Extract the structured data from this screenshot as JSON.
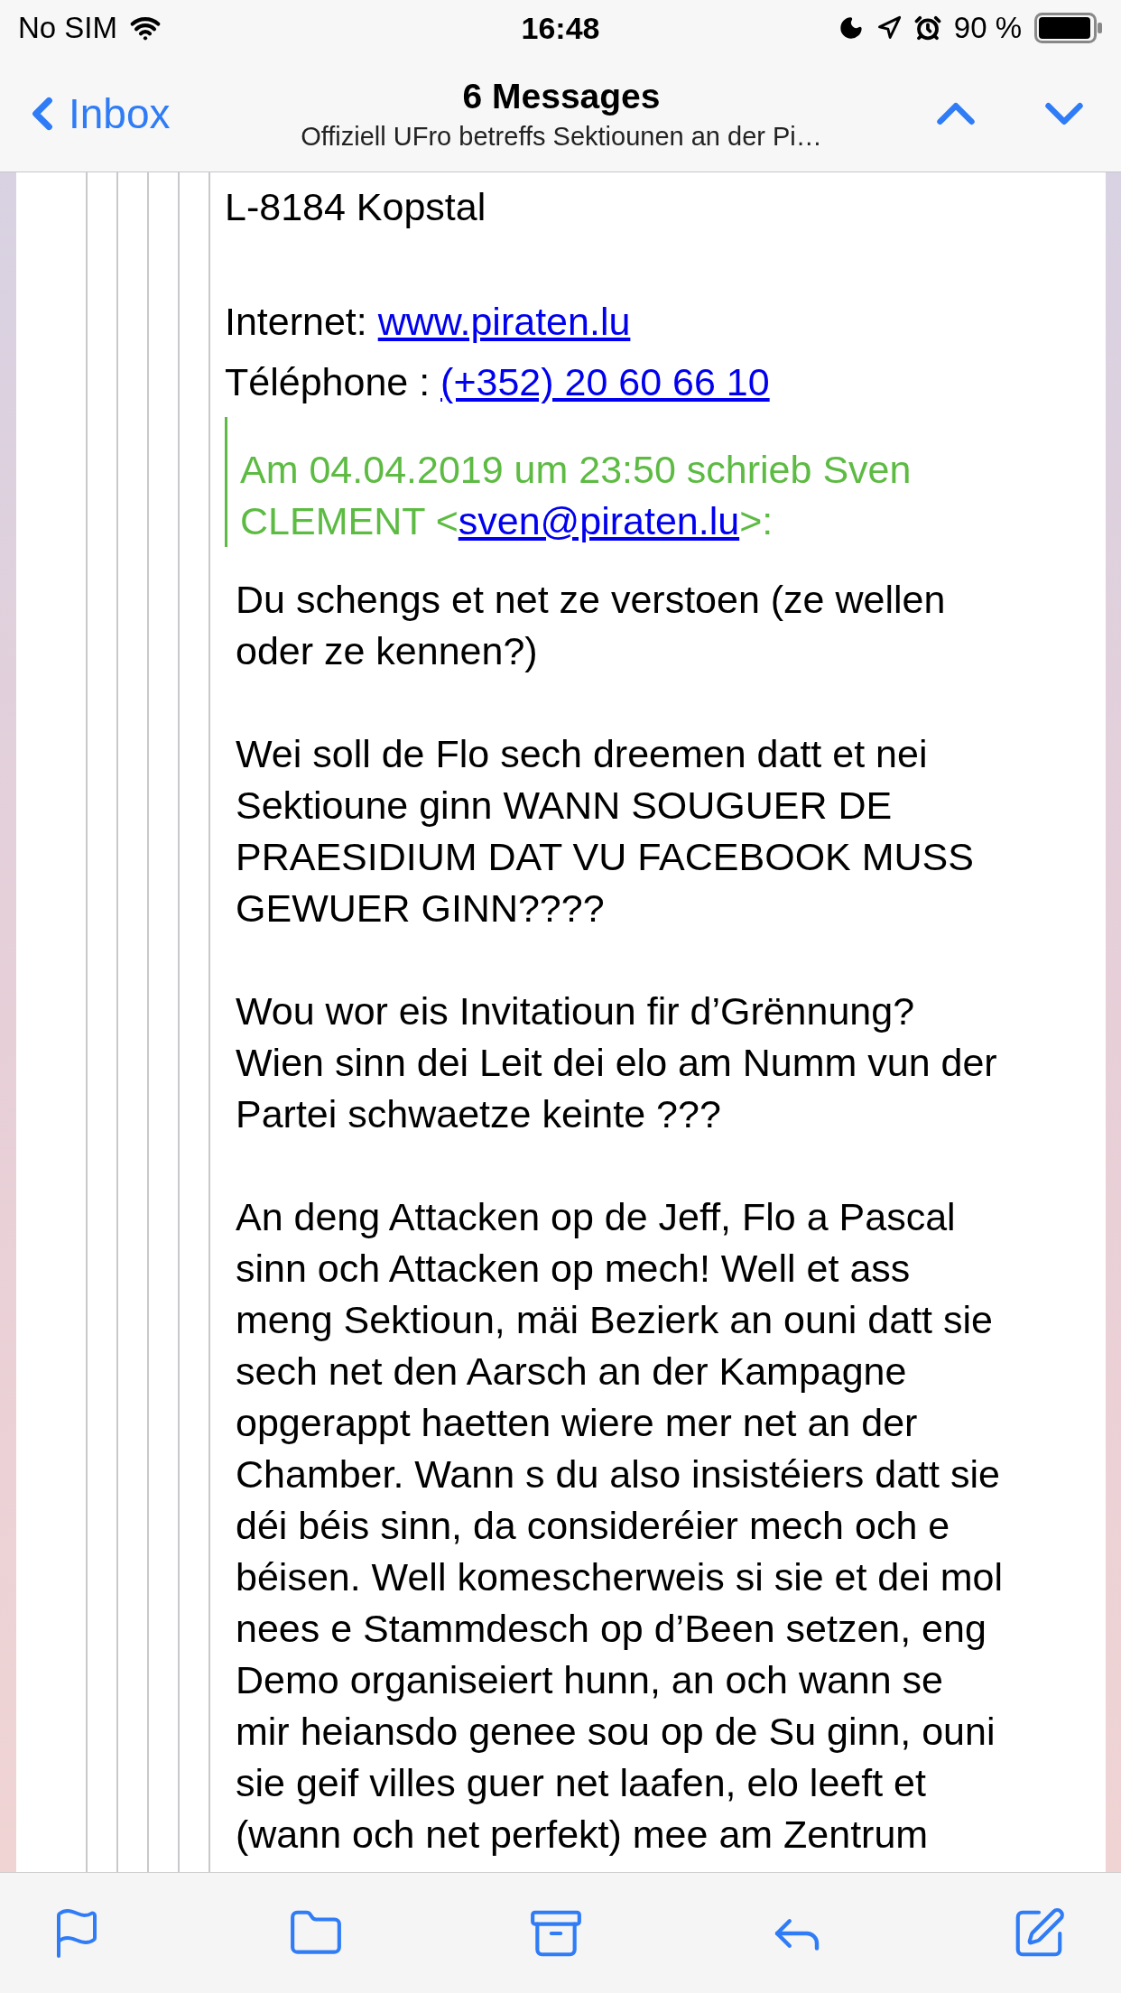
{
  "status_bar": {
    "carrier": "No SIM",
    "time": "16:48",
    "battery": "90 %"
  },
  "nav": {
    "back": "Inbox",
    "title": "6 Messages",
    "subtitle": "Offiziell UFro betreffs Sektiounen an der Pi…"
  },
  "message": {
    "address": "L-8184 Kopstal",
    "contacts": [
      {
        "label": "Internet:",
        "link": "www.piraten.lu"
      },
      {
        "label": "Téléphone :",
        "link": "(+352) 20 60 66 10"
      }
    ],
    "quote_header": {
      "line1": "Am 04.04.2019 um 23:50 schrieb Sven",
      "line2_prefix": "CLEMENT <",
      "email": "sven@piraten.lu",
      "suffix": ">:"
    },
    "paragraphs": [
      [
        "Du schengs et net ze verstoen (ze wellen",
        "oder ze kennen?)"
      ],
      [
        "Wei soll de Flo sech dreemen datt et nei",
        "Sektioune ginn WANN SOUGUER DE",
        "PRAESIDIUM DAT VU FACEBOOK MUSS",
        "GEWUER GINN????"
      ],
      [
        "Wou wor eis Invitatioun fir d’Grënnung?",
        "Wien sinn dei Leit dei elo am Numm vun der",
        "Partei schwaetze keinte ???"
      ],
      [
        "An deng Attacken op de Jeff, Flo a Pascal",
        "sinn och Attacken op mech! Well et ass",
        "meng Sektioun, mäi Bezierk an ouni datt sie",
        "sech net den Aarsch an der Kampagne",
        "opgerappt haetten wiere mer net an der",
        "Chamber. Wann s du also insistéiers datt sie",
        "déi béis sinn, da consideréier mech och e",
        "béisen. Well komescherweis si sie et dei mol",
        "nees e Stammdesch op d’Been setzen, eng",
        "Demo organiseiert hunn, an och wann se",
        "mir heiansdo genee sou op de Su ginn, ouni",
        "sie geif villes guer net laafen, elo leeft et",
        "(wann och net perfekt) mee am Zentrum"
      ]
    ]
  }
}
